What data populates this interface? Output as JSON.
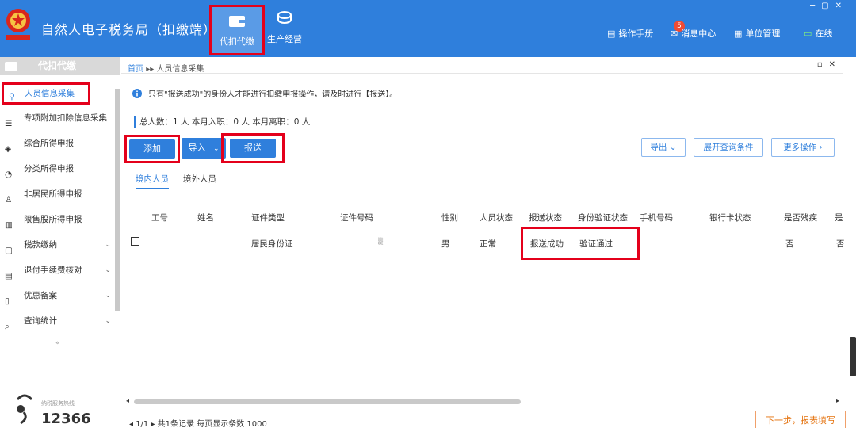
{
  "header": {
    "app_title": "自然人电子税务局（扣缴端）",
    "nav": [
      {
        "label": "代扣代缴",
        "icon": "wallet-icon",
        "active": true
      },
      {
        "label": "生产经营",
        "icon": "coins-icon",
        "active": false
      }
    ],
    "right_items": [
      {
        "label": "操作手册",
        "icon": "book-icon"
      },
      {
        "label": "消息中心",
        "icon": "message-icon",
        "badge": "5"
      },
      {
        "label": "单位管理",
        "icon": "building-icon"
      },
      {
        "label": "在线",
        "icon": "monitor-icon"
      }
    ],
    "accent_color": "#2f7fdc"
  },
  "sidebar": {
    "title": "代扣代缴",
    "items": [
      {
        "label": "人员信息采集",
        "icon": "person-icon",
        "active": true
      },
      {
        "label": "专项附加扣除信息采集",
        "icon": "list-icon"
      },
      {
        "label": "综合所得申报",
        "icon": "layers-icon"
      },
      {
        "label": "分类所得申报",
        "icon": "pie-chart-icon"
      },
      {
        "label": "非居民所得申报",
        "icon": "user-icon"
      },
      {
        "label": "限售股所得申报",
        "icon": "bar-chart-icon"
      },
      {
        "label": "税款缴纳",
        "icon": "folder-icon",
        "chevron": "⌄"
      },
      {
        "label": "退付手续费核对",
        "icon": "document-icon",
        "chevron": "⌄"
      },
      {
        "label": "优惠备案",
        "icon": "file-icon",
        "chevron": "⌄"
      },
      {
        "label": "查询统计",
        "icon": "search-list-icon",
        "chevron": "⌄"
      }
    ],
    "collapse_glyph": "«",
    "logo_number": "12366",
    "logo_sub": "纳税服务热线"
  },
  "main": {
    "breadcrumb_home": "首页",
    "breadcrumb_sep": "▸▸",
    "breadcrumb_current": "人员信息采集",
    "notice": "只有\"报送成功\"的身份人才能进行扣缴申报操作，请及时进行【报送】。",
    "stats": "总人数：1 人   本月入职：0 人   本月离职：0 人",
    "buttons": {
      "add": "添加",
      "import": "导入",
      "import_caret": "⌄",
      "report": "报送",
      "export": "导出",
      "expand": "展开查询条件",
      "more": "更多操作"
    },
    "subtabs": [
      "境内人员",
      "境外人员"
    ],
    "table": {
      "columns": [
        "工号",
        "姓名",
        "证件类型",
        "证件号码",
        "性别",
        "人员状态",
        "报送状态",
        "身份验证状态",
        "手机号码",
        "银行卡状态",
        "是否残疾",
        "是"
      ],
      "rows": [
        {
          "id_type": "居民身份证",
          "id_number": "▒",
          "gender": "男",
          "status": "正常",
          "report_status": "报送成功",
          "verify_status": "验证通过",
          "disabled": "否",
          "extra": "否"
        }
      ]
    },
    "pager": "◂ 1/1 ▸  共1条记录   每页显示条数     1000",
    "next_button": "下一步，报表填写"
  }
}
